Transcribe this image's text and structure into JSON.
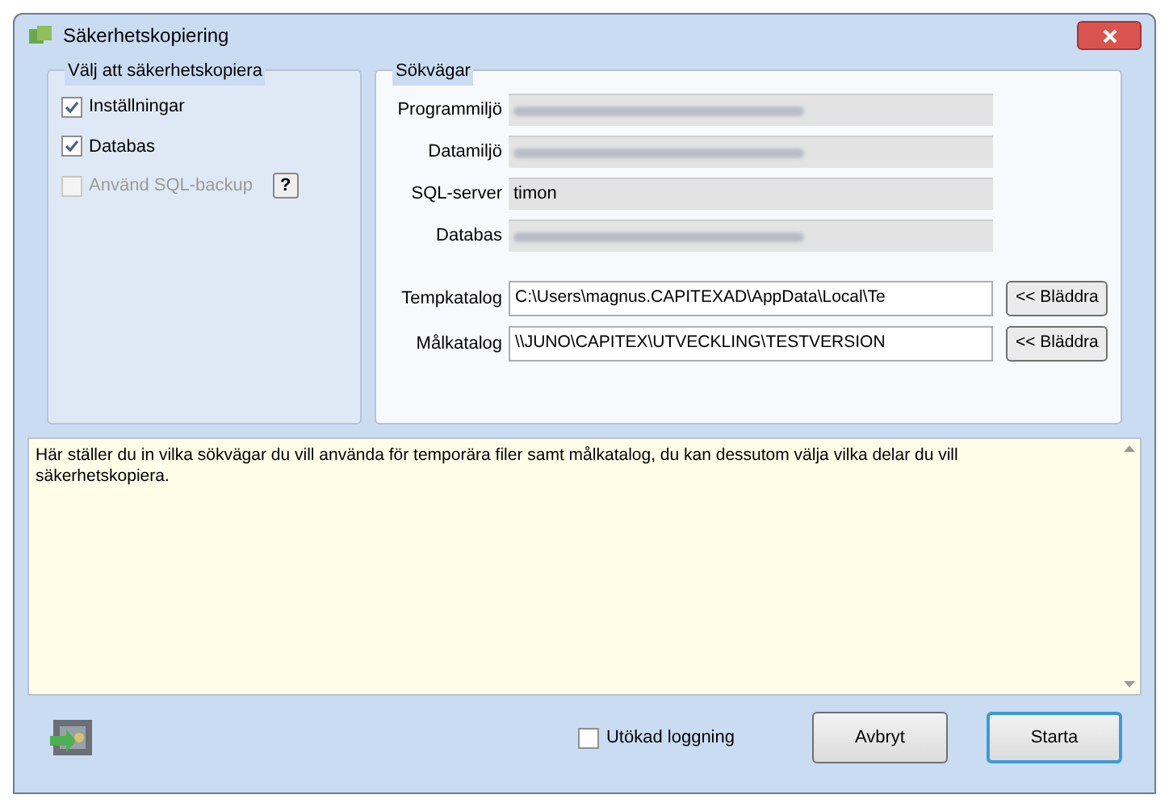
{
  "window": {
    "title": "Säkerhetskopiering"
  },
  "backup_group": {
    "title": "Välj att säkerhetskopiera",
    "options": [
      {
        "label": "Inställningar",
        "checked": true,
        "disabled": false
      },
      {
        "label": "Databas",
        "checked": true,
        "disabled": false
      },
      {
        "label": "Använd SQL-backup",
        "checked": false,
        "disabled": true,
        "help": "?"
      }
    ]
  },
  "paths_group": {
    "title": "Sökvägar",
    "fields": [
      {
        "label": "Programmiljö",
        "kind": "readonly",
        "blurred": true
      },
      {
        "label": "Datamiljö",
        "kind": "readonly",
        "blurred": true
      },
      {
        "label": "SQL-server",
        "kind": "readonly",
        "value": "timon"
      },
      {
        "label": "Databas",
        "kind": "readonly",
        "blurred": true
      },
      {
        "label": "Tempkatalog",
        "kind": "browse",
        "value": "C:\\Users\\magnus.CAPITEXAD\\AppData\\Local\\Te",
        "button": "<< Bläddra"
      },
      {
        "label": "Målkatalog",
        "kind": "browse",
        "value": "\\\\JUNO\\CAPITEX\\UTVECKLING\\TESTVERSION",
        "button": "<< Bläddra"
      }
    ]
  },
  "info_text": "Här ställer du in vilka sökvägar du vill använda för temporära filer samt målkatalog, du kan dessutom välja vilka delar du vill säkerhetskopiera.",
  "footer": {
    "logging": {
      "label": "Utökad loggning",
      "checked": false
    },
    "buttons": [
      {
        "label": "Avbryt",
        "selected": false
      },
      {
        "label": "Starta",
        "selected": true
      }
    ]
  }
}
